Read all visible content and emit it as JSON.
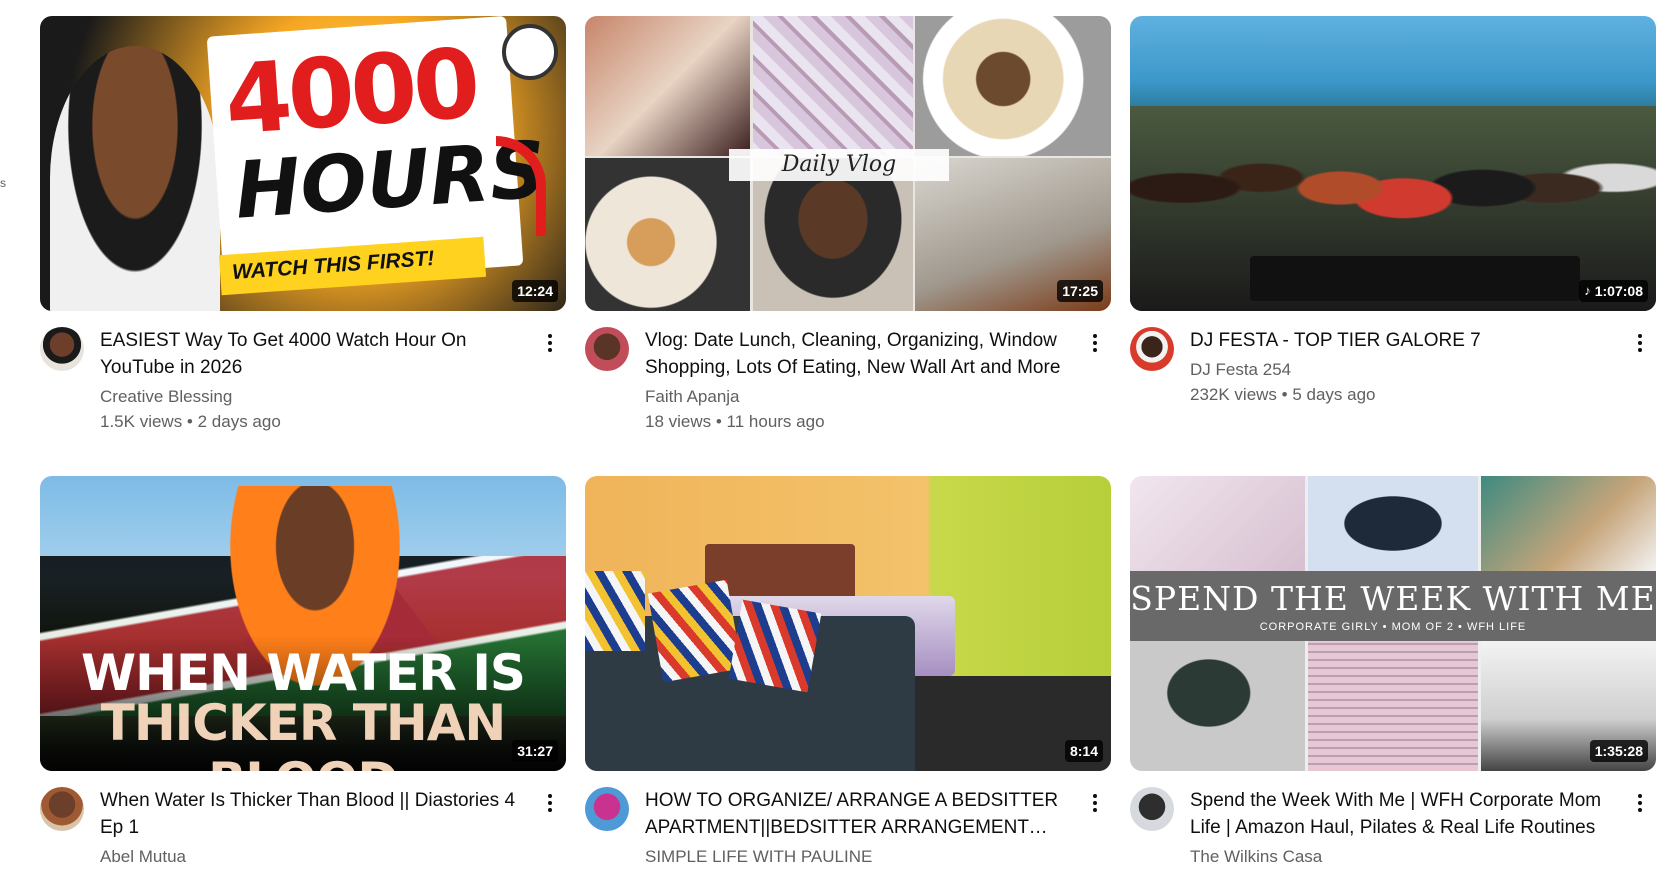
{
  "edge_fragment": "s",
  "videos": [
    {
      "title": "EASIEST Way To Get 4000 Watch Hour On YouTube in 2026",
      "channel": "Creative Blessing",
      "stats": "1.5K views • 2 days ago",
      "duration": "12:24",
      "thumb_text": {
        "big": "4000",
        "hours": "HOURS",
        "banner": "WATCH THIS FIRST!"
      }
    },
    {
      "title": "Vlog: Date Lunch, Cleaning, Organizing, Window Shopping, Lots Of Eating, New Wall Art and More",
      "channel": "Faith Apanja",
      "stats": "18 views • 11 hours ago",
      "duration": "17:25",
      "thumb_text": {
        "label": "Daily Vlog"
      }
    },
    {
      "title": "DJ FESTA - TOP TIER GALORE 7",
      "channel": "DJ Festa 254",
      "stats": "232K views • 5 days ago",
      "duration": "1:07:08",
      "duration_icon": "music-note-icon"
    },
    {
      "title": "When Water Is Thicker Than Blood || Diastories 4 Ep 1",
      "channel": "Abel Mutua",
      "stats": "",
      "duration": "31:27",
      "thumb_text": {
        "line1": "WHEN WATER IS",
        "line2": "THICKER THAN BLOOD"
      }
    },
    {
      "title": "HOW TO ORGANIZE/ ARRANGE A BEDSITTER APARTMENT||BEDSITTER ARRANGEMENT IDEAS",
      "channel": "SIMPLE LIFE WITH PAULINE",
      "stats": "",
      "duration": "8:14"
    },
    {
      "title": "Spend the Week With Me | WFH Corporate Mom Life | Amazon Haul, Pilates & Real Life Routines",
      "channel": "The Wilkins Casa",
      "stats": "",
      "duration": "1:35:28",
      "thumb_text": {
        "title": "SPEND THE WEEK WITH ME",
        "sub": "CORPORATE GIRLY • MOM OF 2 • WFH LIFE"
      }
    }
  ]
}
